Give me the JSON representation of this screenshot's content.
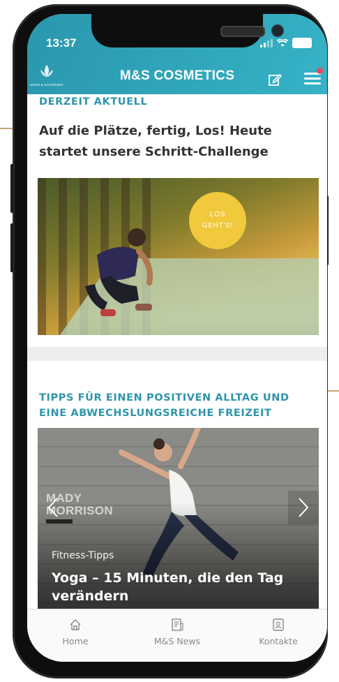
{
  "status_bar": {
    "time": "13:37"
  },
  "header": {
    "title": "M&S COSMETICS",
    "logo_text": "MANN & SCHRÖDER"
  },
  "section1": {
    "label": "DERZEIT AKTUELL",
    "headline": "Auf die Plätze, fertig, Los! Heute startet unsere Schritt-Challenge",
    "badge": "LOS\nGEHT'S!"
  },
  "section2": {
    "label": "TIPPS FÜR EINEN POSITIVEN ALLTAG UND EINE ABWECHSLUNGSREICHE FREIZEIT",
    "card": {
      "brand": "MADY\nMORRISON",
      "category": "Fitness-Tipps",
      "title": "Yoga – 15 Minuten, die den Tag verändern"
    }
  },
  "tabbar": {
    "tabs": [
      {
        "label": "Home",
        "icon": "home-icon"
      },
      {
        "label": "M&S News",
        "icon": "news-icon"
      },
      {
        "label": "Kontakte",
        "icon": "contacts-icon"
      }
    ]
  },
  "colors": {
    "accent": "#2e95ab",
    "header_bg": "#36b2c6",
    "badge": "#f0c93c",
    "notification": "#e84b5a"
  }
}
